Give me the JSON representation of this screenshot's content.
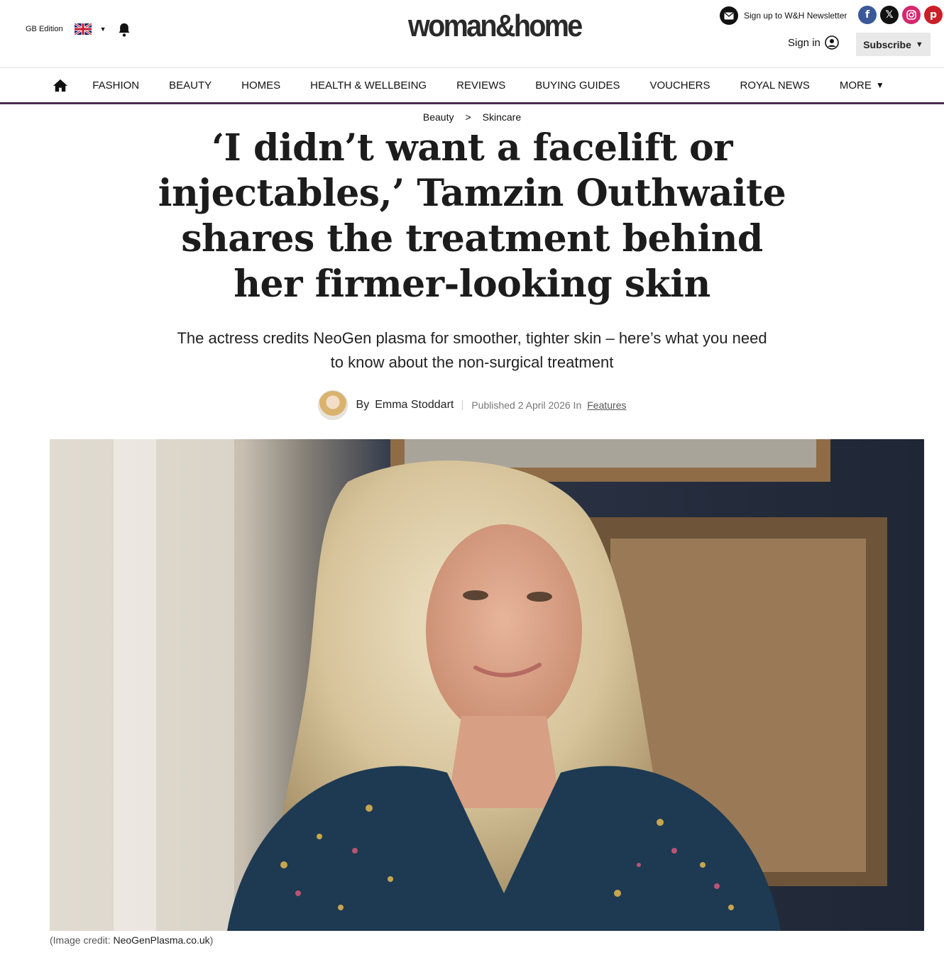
{
  "header": {
    "edition_label": "GB Edition",
    "logo_text": "woman&home",
    "newsletter_label": "Sign up to W&H Newsletter",
    "signin_label": "Sign in",
    "subscribe_label": "Subscribe",
    "socials": [
      "facebook-icon",
      "x-icon",
      "instagram-icon",
      "pinterest-icon"
    ],
    "colors": {
      "facebook": "#3b5998",
      "x": "#111111",
      "instagram": "#d6276f",
      "pinterest": "#cb1f27",
      "nav_border": "#4b2e4f"
    }
  },
  "nav": {
    "items": [
      "Fashion",
      "Beauty",
      "Homes",
      "Health & Wellbeing",
      "Reviews",
      "Buying Guides",
      "Vouchers",
      "Royal News"
    ],
    "more_label": "More"
  },
  "breadcrumb": {
    "parent": "Beauty",
    "separator": ">",
    "current": "Skincare"
  },
  "article": {
    "headline": "‘I didn’t want a facelift or injectables,’ Tamzin Outhwaite shares the treatment behind her firmer-looking skin",
    "standfirst": "The actress credits NeoGen plasma for smoother, tighter skin – here’s what you need to know about the non-surgical treatment",
    "author_prefix": "By",
    "author": "Emma Stoddart",
    "published_label": "Published 2 April 2026 In",
    "category": "Features",
    "image_credit_prefix": "(Image credit:",
    "image_credit_source": "NeoGenPlasma.co.uk",
    "image_credit_suffix": ")"
  }
}
